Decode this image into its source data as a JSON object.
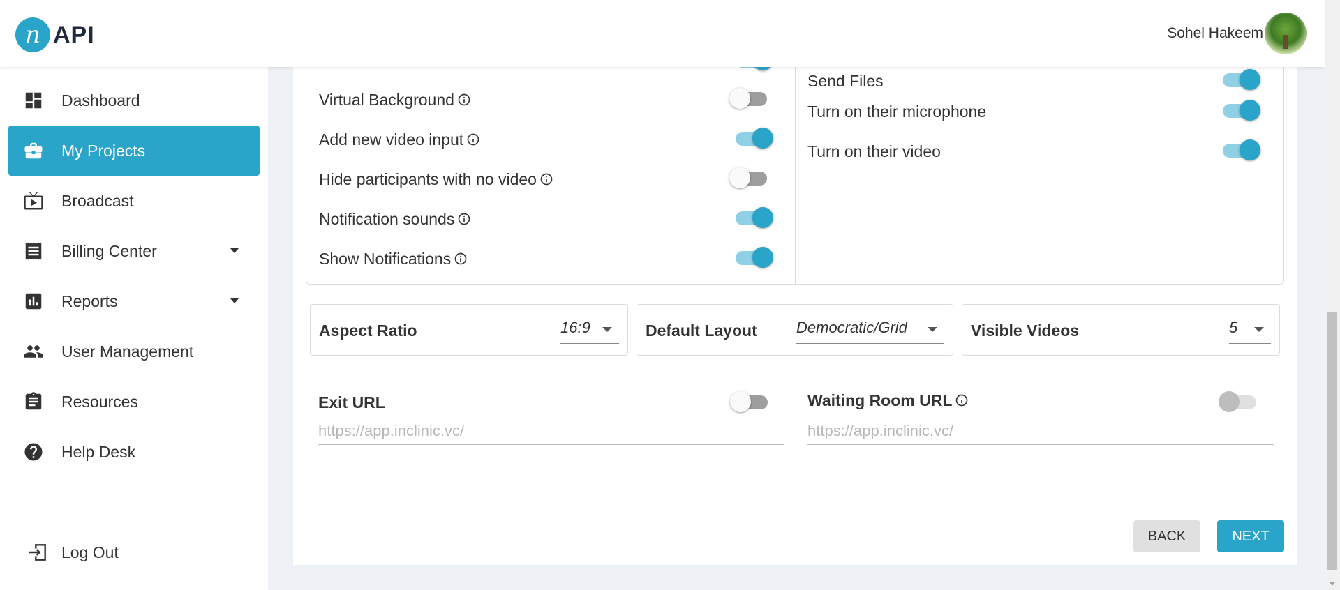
{
  "header": {
    "logo_mark": "n",
    "logo_text": "API",
    "user_name": "Sohel Hakeem"
  },
  "sidebar": {
    "items": [
      {
        "label": "Dashboard",
        "icon": "dashboard-icon"
      },
      {
        "label": "My Projects",
        "icon": "briefcase-icon",
        "active": true
      },
      {
        "label": "Broadcast",
        "icon": "tv-play-icon"
      },
      {
        "label": "Billing Center",
        "icon": "receipt-icon",
        "has_dropdown": true
      },
      {
        "label": "Reports",
        "icon": "bar-chart-icon",
        "has_dropdown": true
      },
      {
        "label": "User Management",
        "icon": "people-icon"
      },
      {
        "label": "Resources",
        "icon": "clipboard-icon"
      },
      {
        "label": "Help Desk",
        "icon": "help-circle-icon"
      }
    ],
    "logout_label": "Log Out"
  },
  "options_left": [
    {
      "label": "Virtual Background",
      "info": true,
      "on": false
    },
    {
      "label": "Add new video input",
      "info": true,
      "on": true
    },
    {
      "label": "Hide participants with no video",
      "info": true,
      "on": false
    },
    {
      "label": "Notification sounds",
      "info": true,
      "on": true
    },
    {
      "label": "Show Notifications",
      "info": true,
      "on": true
    }
  ],
  "options_right": [
    {
      "label": "Send Files",
      "on": true
    },
    {
      "label": "Turn on their microphone",
      "on": true
    },
    {
      "label": "Turn on their video",
      "on": true
    }
  ],
  "selects": {
    "aspect_ratio": {
      "label": "Aspect Ratio",
      "value": "16:9"
    },
    "default_layout": {
      "label": "Default Layout",
      "value": "Democratic/Grid"
    },
    "visible_videos": {
      "label": "Visible Videos",
      "value": "5"
    }
  },
  "exit_url": {
    "label": "Exit URL",
    "placeholder": "https://app.inclinic.vc/",
    "enabled": false
  },
  "waiting_room_url": {
    "label": "Waiting Room URL",
    "placeholder": "https://app.inclinic.vc/",
    "enabled": false,
    "disabled": true
  },
  "buttons": {
    "back": "BACK",
    "next": "NEXT"
  },
  "colors": {
    "accent": "#2aa4c9",
    "accent_light": "#8fd0e4"
  }
}
